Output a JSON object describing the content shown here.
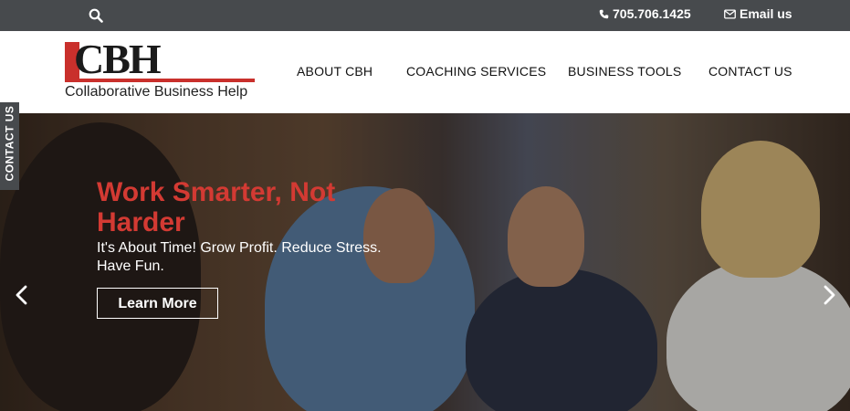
{
  "topbar": {
    "phone": "705.706.1425",
    "email_label": "Email us",
    "icons": {
      "search": "search-icon",
      "phone": "phone-icon",
      "email": "envelope-icon"
    }
  },
  "logo": {
    "mark": "CBH",
    "tagline": "Collaborative Business Help"
  },
  "nav": {
    "items": [
      {
        "label": "ABOUT CBH"
      },
      {
        "label": "COACHING SERVICES"
      },
      {
        "label": "BUSINESS TOOLS"
      },
      {
        "label": "CONTACT US"
      }
    ]
  },
  "side_tab": {
    "label": "CONTACT US"
  },
  "hero": {
    "headline": "Work Smarter, Not Harder",
    "subtext": "It's About Time! Grow Profit. Reduce Stress. Have Fun.",
    "cta_label": "Learn More",
    "headline_color": "#d33a33"
  },
  "colors": {
    "topbar": "#474a4d",
    "accent": "#c9302c"
  }
}
